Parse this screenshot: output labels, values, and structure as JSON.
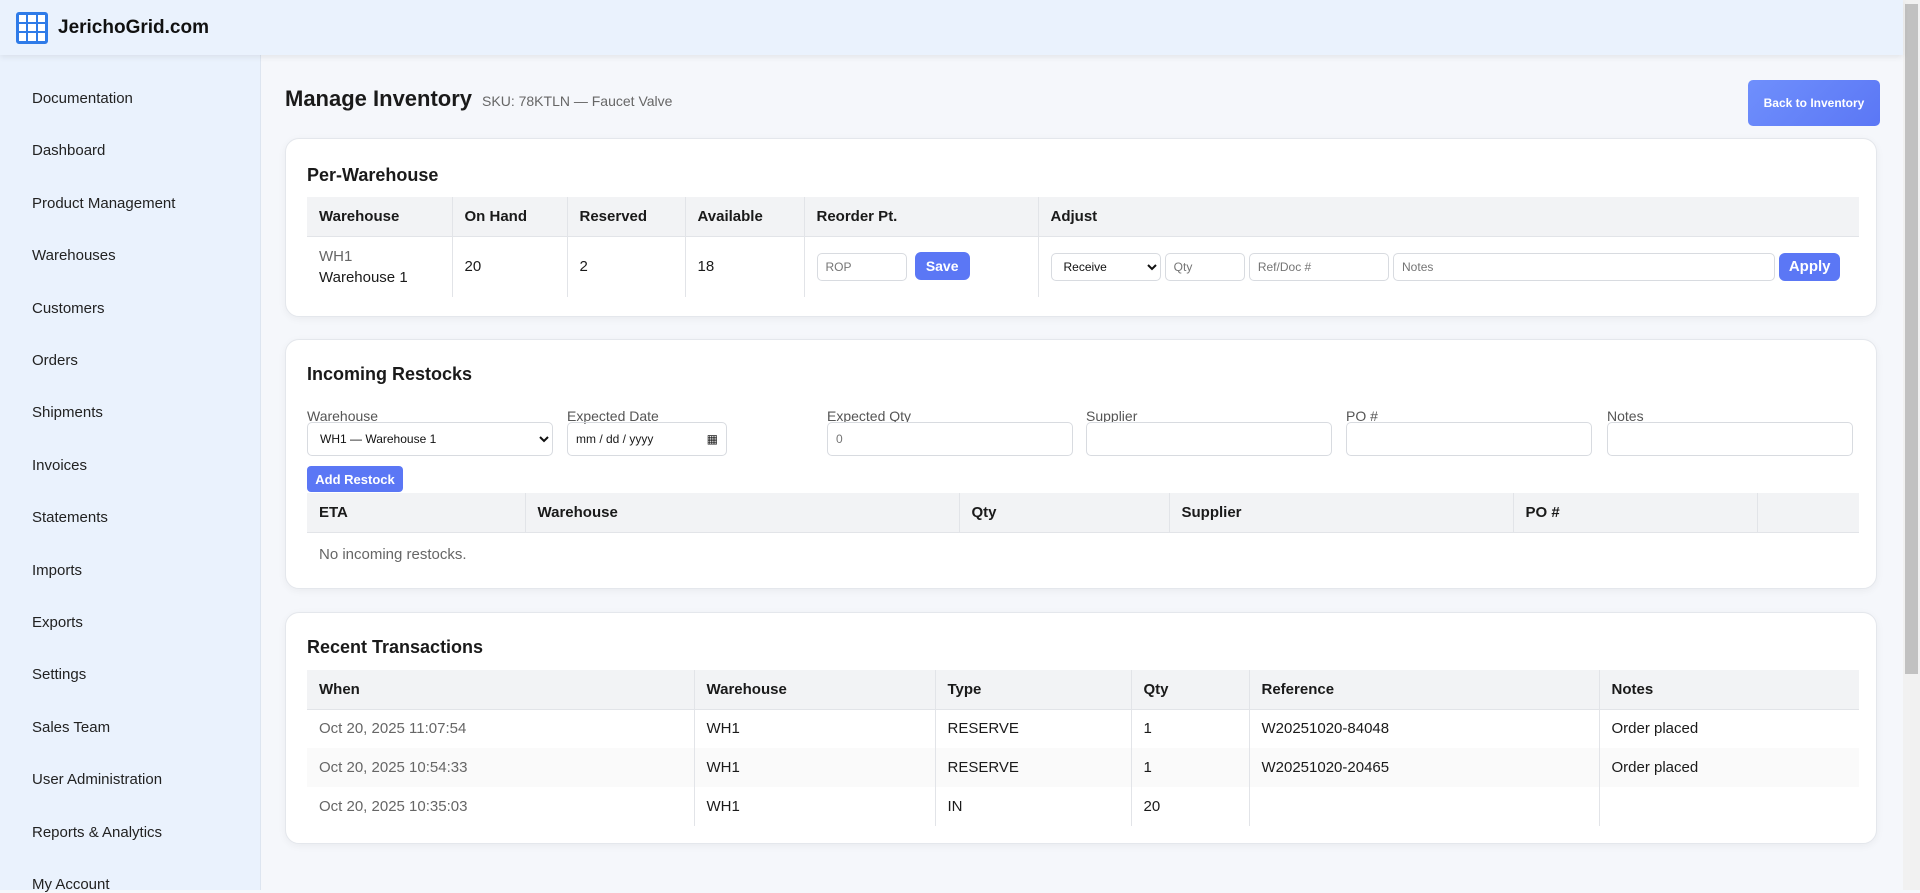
{
  "app": {
    "name": "JerichoGrid.com"
  },
  "sidebar": {
    "items": [
      "Documentation",
      "Dashboard",
      "Product Management",
      "Warehouses",
      "Customers",
      "Orders",
      "Shipments",
      "Invoices",
      "Statements",
      "Imports",
      "Exports",
      "Settings",
      "Sales Team",
      "User Administration",
      "Reports & Analytics",
      "My Account"
    ]
  },
  "page": {
    "title": "Manage Inventory",
    "subtitle": "SKU: 78KTLN — Faucet Valve",
    "back_label": "Back to Inventory"
  },
  "per_warehouse": {
    "heading": "Per-Warehouse",
    "headers": [
      "Warehouse",
      "On Hand",
      "Reserved",
      "Available",
      "Reorder Pt.",
      "Adjust"
    ],
    "row": {
      "code": "WH1",
      "name": "Warehouse 1",
      "on_hand": "20",
      "reserved": "2",
      "available": "18"
    },
    "rop_placeholder": "ROP",
    "save_label": "Save",
    "adjust_type": "Receive",
    "qty_placeholder": "Qty",
    "ref_placeholder": "Ref/Doc #",
    "notes_placeholder": "Notes",
    "apply_label": "Apply"
  },
  "restocks": {
    "heading": "Incoming Restocks",
    "labels": [
      "Warehouse",
      "Expected Date",
      "Expected Qty",
      "Supplier",
      "PO #",
      "Notes"
    ],
    "warehouse_value": "WH1 — Warehouse 1",
    "date_placeholder": "mm / dd / yyyy",
    "qty_placeholder": "0",
    "add_label": "Add Restock",
    "headers": [
      "ETA",
      "Warehouse",
      "Qty",
      "Supplier",
      "PO #",
      ""
    ],
    "empty": "No incoming restocks."
  },
  "transactions": {
    "heading": "Recent Transactions",
    "headers": [
      "When",
      "Warehouse",
      "Type",
      "Qty",
      "Reference",
      "Notes"
    ],
    "rows": [
      [
        "Oct 20, 2025 11:07:54",
        "WH1",
        "RESERVE",
        "1",
        "W20251020-84048",
        "Order placed"
      ],
      [
        "Oct 20, 2025 10:54:33",
        "WH1",
        "RESERVE",
        "1",
        "W20251020-20465",
        "Order placed"
      ],
      [
        "Oct 20, 2025 10:35:03",
        "WH1",
        "IN",
        "20",
        "",
        ""
      ]
    ]
  }
}
